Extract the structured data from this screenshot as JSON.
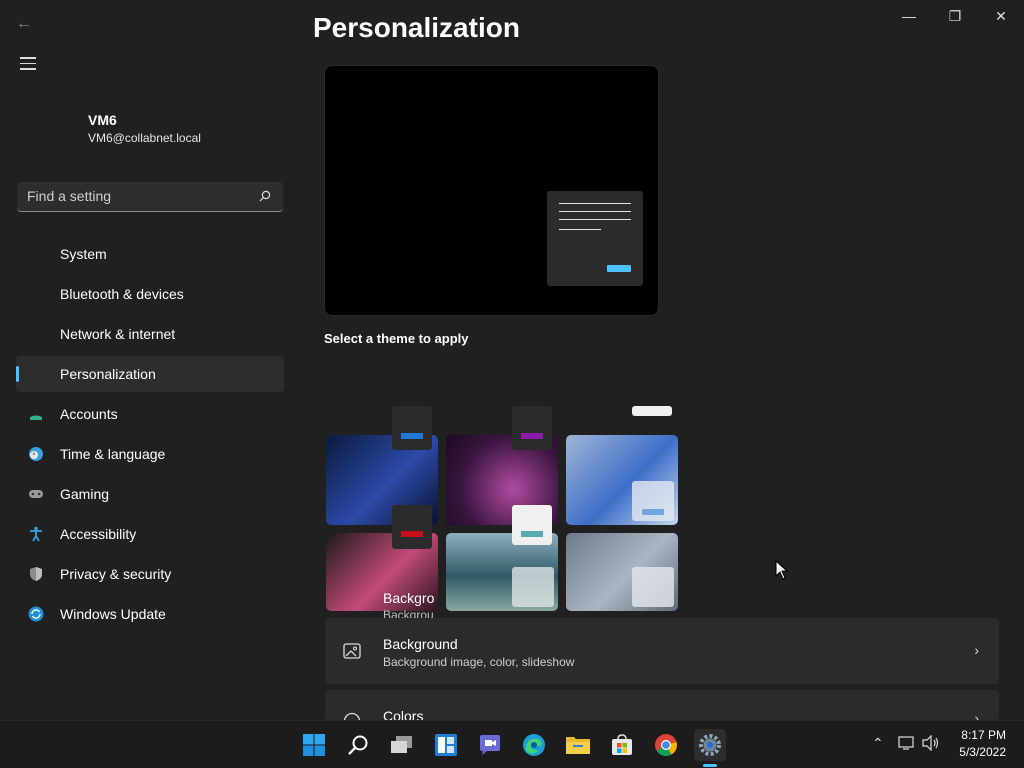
{
  "window": {
    "back_icon": "back-arrow-icon",
    "minimize_icon": "minimize-icon",
    "restore_icon": "restore-icon",
    "close_icon": "close-icon"
  },
  "user": {
    "name": "VM6",
    "email": "VM6@collabnet.local"
  },
  "search": {
    "placeholder": "Find a setting"
  },
  "nav": {
    "items": [
      {
        "label": "System",
        "icon": "system-icon"
      },
      {
        "label": "Bluetooth & devices",
        "icon": "bluetooth-icon"
      },
      {
        "label": "Network & internet",
        "icon": "network-icon"
      },
      {
        "label": "Personalization",
        "icon": "brush-icon",
        "selected": true
      },
      {
        "label": "Accounts",
        "icon": "accounts-icon"
      },
      {
        "label": "Time & language",
        "icon": "clock-globe-icon"
      },
      {
        "label": "Gaming",
        "icon": "gamepad-icon"
      },
      {
        "label": "Accessibility",
        "icon": "accessibility-icon"
      },
      {
        "label": "Privacy & security",
        "icon": "shield-icon"
      },
      {
        "label": "Windows Update",
        "icon": "update-icon"
      }
    ]
  },
  "main": {
    "title": "Personalization",
    "theme_section_label": "Select a theme to apply",
    "rows": [
      {
        "title": "Background",
        "subtitle": "Background image, color, slideshow",
        "icon": "image-icon"
      },
      {
        "title": "Colors",
        "subtitle": "",
        "icon": "palette-icon"
      }
    ],
    "ghost_title": "Backgro",
    "ghost_sub": "Backgrou"
  },
  "taskbar": {
    "apps": [
      "start-icon",
      "search-icon",
      "task-view-icon",
      "widgets-icon",
      "teams-chat-icon",
      "edge-icon",
      "file-explorer-icon",
      "store-icon",
      "chrome-icon",
      "settings-icon"
    ],
    "time": "8:17 PM",
    "date": "5/3/2022"
  },
  "colors": {
    "accent": "#4cc2ff",
    "background": "#202020",
    "card": "#2b2b2b"
  }
}
